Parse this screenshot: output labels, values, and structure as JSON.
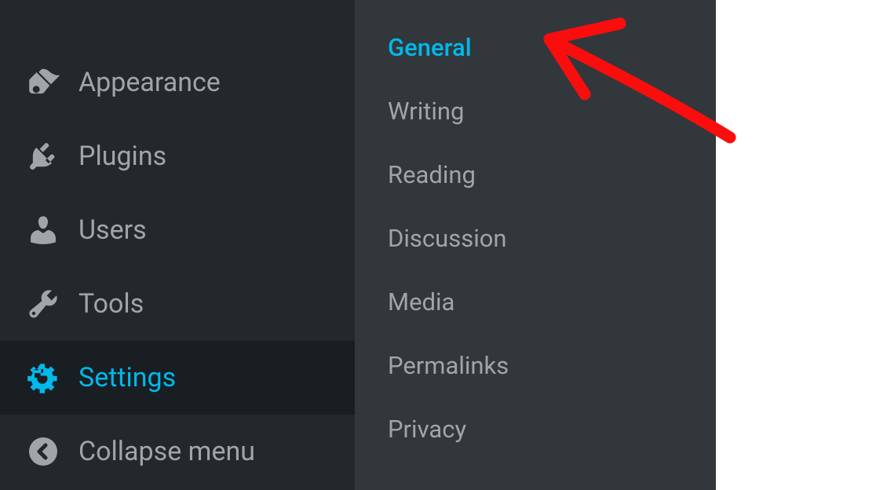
{
  "sidebar": {
    "items": [
      {
        "label": "Appearance",
        "icon": "appearance"
      },
      {
        "label": "Plugins",
        "icon": "plugins"
      },
      {
        "label": "Users",
        "icon": "users"
      },
      {
        "label": "Tools",
        "icon": "tools"
      },
      {
        "label": "Settings",
        "icon": "settings",
        "active": true
      }
    ],
    "collapse_label": "Collapse menu"
  },
  "submenu": {
    "items": [
      {
        "label": "General",
        "active": true
      },
      {
        "label": "Writing"
      },
      {
        "label": "Reading"
      },
      {
        "label": "Discussion"
      },
      {
        "label": "Media"
      },
      {
        "label": "Permalinks"
      },
      {
        "label": "Privacy"
      }
    ]
  }
}
